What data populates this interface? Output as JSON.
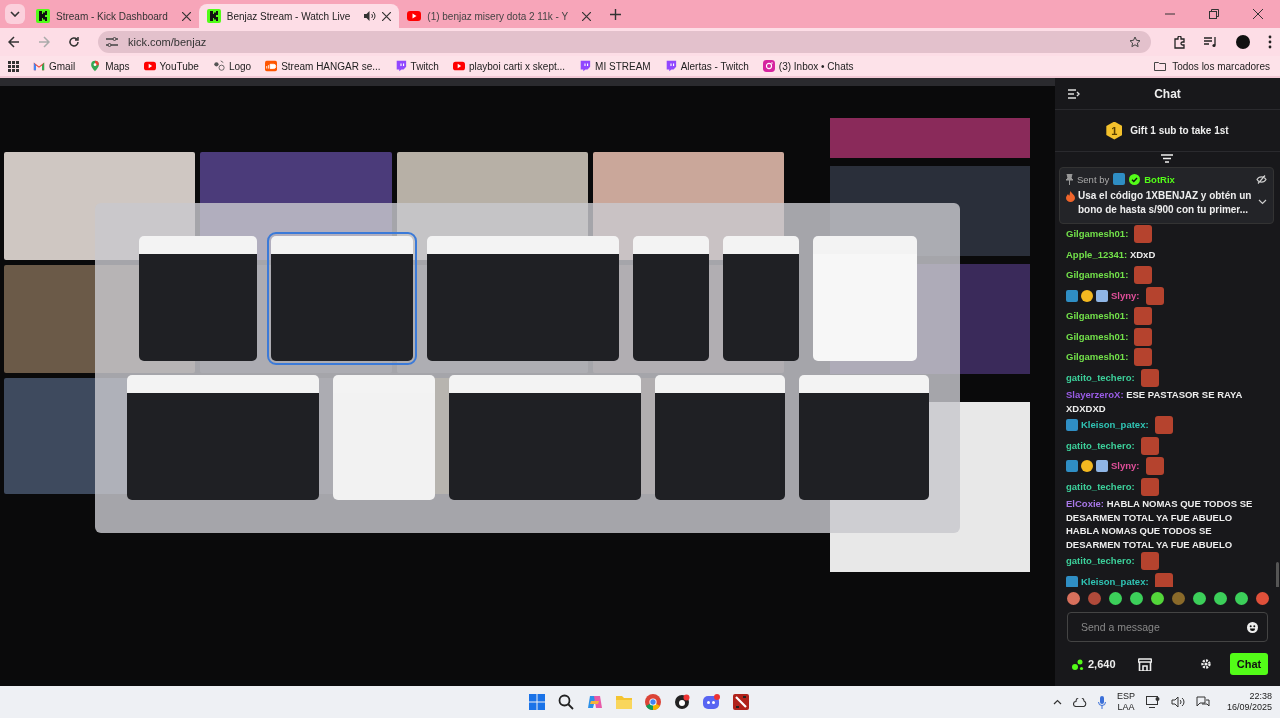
{
  "browser": {
    "tabs": [
      {
        "title": "Stream - Kick Dashboard",
        "kind": "kick",
        "selected": false,
        "audio": false
      },
      {
        "title": "Benjaz Stream - Watch Live",
        "kind": "kick",
        "selected": true,
        "audio": true
      },
      {
        "title": "(1) benjaz misery dota 2 11k - Y",
        "kind": "youtube",
        "selected": false,
        "audio": false
      }
    ],
    "address": "kick.com/benjaz",
    "bookmarks": [
      {
        "label": "Gmail",
        "kind": "gmail"
      },
      {
        "label": "Maps",
        "kind": "maps"
      },
      {
        "label": "YouTube",
        "kind": "youtube"
      },
      {
        "label": "Logo",
        "kind": "logo"
      },
      {
        "label": "Stream HANGAR se...",
        "kind": "soundcloud"
      },
      {
        "label": "Twitch",
        "kind": "twitch"
      },
      {
        "label": "playboi carti x skept...",
        "kind": "youtube"
      },
      {
        "label": "MI STREAM",
        "kind": "twitch"
      },
      {
        "label": "Alertas - Twitch",
        "kind": "twitch"
      },
      {
        "label": "(3) Inbox • Chats",
        "kind": "instagram"
      }
    ],
    "all_bookmarks": "Todos los marcadores"
  },
  "chat": {
    "title": "Chat",
    "gift_badge": "1",
    "gift_text": "Gift 1 sub to take 1st",
    "pinned": {
      "sent_by": "Sent by",
      "author": "BotRix",
      "message": "Usa el código 1XBENJAZ y obtén un bono de hasta s/900 con tu primer..."
    },
    "messages": [
      {
        "user": "Gilgamesh01:",
        "color": "#72e04a",
        "kind": "emote"
      },
      {
        "user": "Apple_12341:",
        "color": "#72e04a",
        "kind": "text",
        "text": "XDxD"
      },
      {
        "user": "Gilgamesh01:",
        "color": "#72e04a",
        "kind": "emote"
      },
      {
        "user": "Slyny:",
        "color": "#e0509a",
        "badges": [
          {
            "kind": "moderator"
          },
          {
            "kind": "subscriber"
          },
          {
            "kind": "gifter"
          }
        ],
        "kind": "emote"
      },
      {
        "user": "Gilgamesh01:",
        "color": "#72e04a",
        "kind": "emote"
      },
      {
        "user": "Gilgamesh01:",
        "color": "#72e04a",
        "kind": "emote"
      },
      {
        "user": "Gilgamesh01:",
        "color": "#72e04a",
        "kind": "emote"
      },
      {
        "user": "gatito_techero:",
        "color": "#3ccf9a",
        "kind": "emote"
      },
      {
        "user": "SlayerzeroX:",
        "color": "#9a5ce6",
        "kind": "text",
        "text": "ESE PASTASOR SE RAYA XDXDXD"
      },
      {
        "user": "Kleison_patex:",
        "color": "#2fc4b4",
        "badges": [
          {
            "kind": "moderator"
          }
        ],
        "kind": "emote"
      },
      {
        "user": "gatito_techero:",
        "color": "#3ccf9a",
        "kind": "emote"
      },
      {
        "user": "Slyny:",
        "color": "#e0509a",
        "badges": [
          {
            "kind": "moderator"
          },
          {
            "kind": "subscriber"
          },
          {
            "kind": "gifter"
          }
        ],
        "kind": "emote"
      },
      {
        "user": "gatito_techero:",
        "color": "#3ccf9a",
        "kind": "emote"
      },
      {
        "user": "ElCoxie:",
        "color": "#a878e8",
        "kind": "text",
        "text": "HABLA NOMAS QUE TODOS SE DESARMEN TOTAL YA FUE ABUELO HABLA NOMAS QUE TODOS SE DESARMEN TOTAL YA FUE ABUELO"
      },
      {
        "user": "gatito_techero:",
        "color": "#3ccf9a",
        "kind": "emote"
      },
      {
        "user": "Kleison_patex:",
        "color": "#2fc4b4",
        "badges": [
          {
            "kind": "moderator"
          }
        ],
        "kind": "emote"
      }
    ],
    "input": {
      "placeholder": "Send a message"
    },
    "points": "2,640",
    "send_button": "Chat"
  },
  "taskbar": {
    "language": "ESP",
    "layout": "LAA",
    "time": "22:38",
    "date": "16/09/2025"
  }
}
